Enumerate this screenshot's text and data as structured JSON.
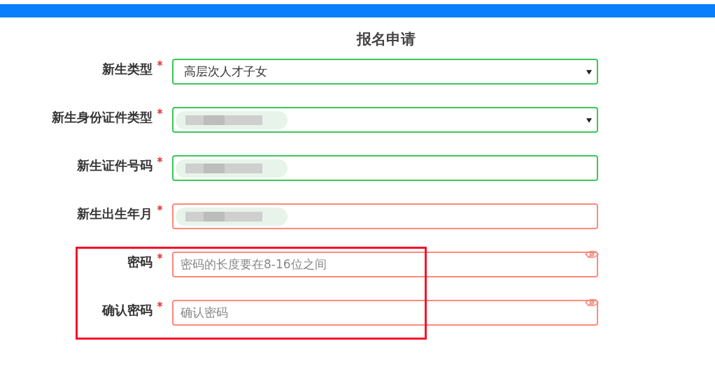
{
  "title": "报名申请",
  "fields": [
    {
      "label": "新生类型",
      "required": true,
      "kind": "select",
      "valid": true,
      "value": "高层次人才子女",
      "redacted": false,
      "highlighted": false
    },
    {
      "label": "新生身份证件类型",
      "required": true,
      "kind": "select",
      "valid": true,
      "redacted": true,
      "highlighted": false
    },
    {
      "label": "新生证件号码",
      "required": true,
      "kind": "text",
      "valid": true,
      "redacted": true,
      "highlighted": false
    },
    {
      "label": "新生出生年月",
      "required": true,
      "kind": "text",
      "valid": false,
      "redacted": true,
      "highlighted": false
    },
    {
      "label": "密码",
      "required": true,
      "kind": "password",
      "valid": false,
      "placeholder": "密码的长度要在8-16位之间",
      "redacted": false,
      "highlighted": true
    },
    {
      "label": "确认密码",
      "required": true,
      "kind": "password",
      "valid": false,
      "placeholder": "确认密码",
      "redacted": false,
      "highlighted": true
    }
  ]
}
